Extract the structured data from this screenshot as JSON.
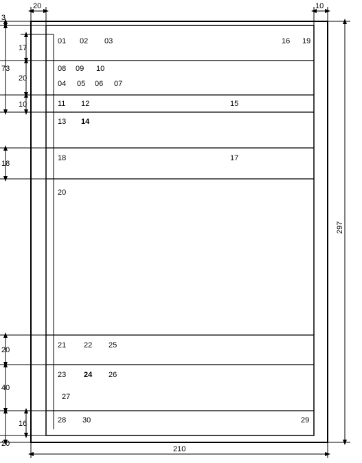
{
  "page": {
    "width_mm": 210,
    "height_mm": 297
  },
  "outer_margins": {
    "left_mm": 20,
    "right_mm": 10,
    "top_mm": 3,
    "bottom_mm": 20
  },
  "vertical_dims": {
    "left_top_73": 73,
    "left_seg_17": 17,
    "left_seg_20": 20,
    "left_seg_10": 10,
    "left_seg_18": 18,
    "left_lower_20": 20,
    "left_lower_40": 40,
    "left_lower_16": 16,
    "left_bottom_20": 20,
    "right_297": 297
  },
  "horizontal_dims": {
    "top_left_20": 20,
    "top_right_10": 10,
    "bottom_210": 210
  },
  "fields": {
    "r1": [
      "01",
      "02",
      "03"
    ],
    "r1r": [
      "16",
      "19"
    ],
    "r2": [
      "08",
      "09",
      "10"
    ],
    "r2b": [
      "04",
      "05",
      "06",
      "07"
    ],
    "r3": [
      "11",
      "12"
    ],
    "r3r": "15",
    "r4": [
      "13",
      "14"
    ],
    "r5": "18",
    "r5r": "17",
    "r6": "20",
    "r7": [
      "21",
      "22",
      "25"
    ],
    "r8": [
      "23",
      "24",
      "26"
    ],
    "r8b": "27",
    "r9": [
      "28",
      "30"
    ],
    "r9r": "29"
  }
}
